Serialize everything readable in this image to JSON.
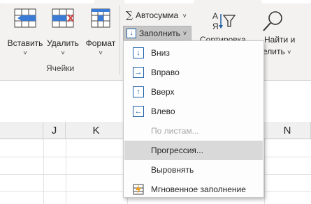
{
  "ribbon": {
    "buttons": {
      "insert": "Вставить",
      "delete": "Удалить",
      "format": "Формат"
    },
    "group_cells_label": "Ячейки",
    "autosum_label": "Автосумма",
    "fill_label": "Заполнить",
    "sort_label": "Сортировка",
    "find_label_line1": "Найти и",
    "find_label_line2": "елить"
  },
  "fill_menu": {
    "items": [
      {
        "label": "Вниз",
        "icon": "fill-down-icon",
        "state": "enabled"
      },
      {
        "label": "Вправо",
        "icon": "fill-right-icon",
        "state": "enabled"
      },
      {
        "label": "Вверх",
        "icon": "fill-up-icon",
        "state": "enabled"
      },
      {
        "label": "Влево",
        "icon": "fill-left-icon",
        "state": "enabled"
      },
      {
        "label": "По листам...",
        "icon": "",
        "state": "disabled"
      },
      {
        "label": "Прогрессия...",
        "icon": "",
        "state": "hover"
      },
      {
        "label": "Выровнять",
        "icon": "",
        "state": "enabled"
      },
      {
        "label": "Мгновенное заполнение",
        "icon": "flash-fill-icon",
        "state": "enabled"
      }
    ]
  },
  "grid": {
    "columns": [
      "J",
      "K",
      "N"
    ]
  },
  "colors": {
    "accent": "#1f5fa8",
    "ribbon_bg": "#f3f2f1",
    "hover_bg": "#d9d9d9",
    "disabled_text": "#a6a6a6"
  }
}
